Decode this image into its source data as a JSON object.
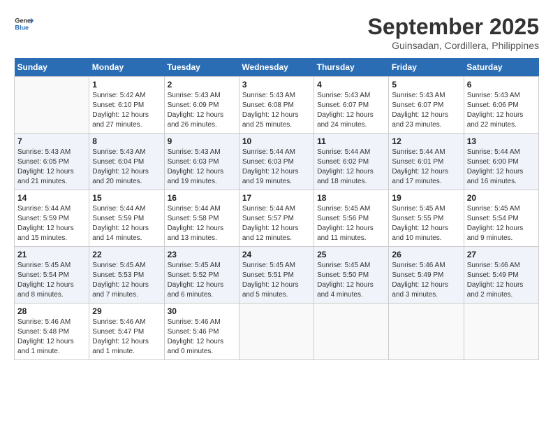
{
  "header": {
    "logo_line1": "General",
    "logo_line2": "Blue",
    "month": "September 2025",
    "location": "Guinsadan, Cordillera, Philippines"
  },
  "weekdays": [
    "Sunday",
    "Monday",
    "Tuesday",
    "Wednesday",
    "Thursday",
    "Friday",
    "Saturday"
  ],
  "weeks": [
    [
      {
        "day": "",
        "detail": ""
      },
      {
        "day": "1",
        "detail": "Sunrise: 5:42 AM\nSunset: 6:10 PM\nDaylight: 12 hours\nand 27 minutes."
      },
      {
        "day": "2",
        "detail": "Sunrise: 5:43 AM\nSunset: 6:09 PM\nDaylight: 12 hours\nand 26 minutes."
      },
      {
        "day": "3",
        "detail": "Sunrise: 5:43 AM\nSunset: 6:08 PM\nDaylight: 12 hours\nand 25 minutes."
      },
      {
        "day": "4",
        "detail": "Sunrise: 5:43 AM\nSunset: 6:07 PM\nDaylight: 12 hours\nand 24 minutes."
      },
      {
        "day": "5",
        "detail": "Sunrise: 5:43 AM\nSunset: 6:07 PM\nDaylight: 12 hours\nand 23 minutes."
      },
      {
        "day": "6",
        "detail": "Sunrise: 5:43 AM\nSunset: 6:06 PM\nDaylight: 12 hours\nand 22 minutes."
      }
    ],
    [
      {
        "day": "7",
        "detail": "Sunrise: 5:43 AM\nSunset: 6:05 PM\nDaylight: 12 hours\nand 21 minutes."
      },
      {
        "day": "8",
        "detail": "Sunrise: 5:43 AM\nSunset: 6:04 PM\nDaylight: 12 hours\nand 20 minutes."
      },
      {
        "day": "9",
        "detail": "Sunrise: 5:43 AM\nSunset: 6:03 PM\nDaylight: 12 hours\nand 19 minutes."
      },
      {
        "day": "10",
        "detail": "Sunrise: 5:44 AM\nSunset: 6:03 PM\nDaylight: 12 hours\nand 19 minutes."
      },
      {
        "day": "11",
        "detail": "Sunrise: 5:44 AM\nSunset: 6:02 PM\nDaylight: 12 hours\nand 18 minutes."
      },
      {
        "day": "12",
        "detail": "Sunrise: 5:44 AM\nSunset: 6:01 PM\nDaylight: 12 hours\nand 17 minutes."
      },
      {
        "day": "13",
        "detail": "Sunrise: 5:44 AM\nSunset: 6:00 PM\nDaylight: 12 hours\nand 16 minutes."
      }
    ],
    [
      {
        "day": "14",
        "detail": "Sunrise: 5:44 AM\nSunset: 5:59 PM\nDaylight: 12 hours\nand 15 minutes."
      },
      {
        "day": "15",
        "detail": "Sunrise: 5:44 AM\nSunset: 5:59 PM\nDaylight: 12 hours\nand 14 minutes."
      },
      {
        "day": "16",
        "detail": "Sunrise: 5:44 AM\nSunset: 5:58 PM\nDaylight: 12 hours\nand 13 minutes."
      },
      {
        "day": "17",
        "detail": "Sunrise: 5:44 AM\nSunset: 5:57 PM\nDaylight: 12 hours\nand 12 minutes."
      },
      {
        "day": "18",
        "detail": "Sunrise: 5:45 AM\nSunset: 5:56 PM\nDaylight: 12 hours\nand 11 minutes."
      },
      {
        "day": "19",
        "detail": "Sunrise: 5:45 AM\nSunset: 5:55 PM\nDaylight: 12 hours\nand 10 minutes."
      },
      {
        "day": "20",
        "detail": "Sunrise: 5:45 AM\nSunset: 5:54 PM\nDaylight: 12 hours\nand 9 minutes."
      }
    ],
    [
      {
        "day": "21",
        "detail": "Sunrise: 5:45 AM\nSunset: 5:54 PM\nDaylight: 12 hours\nand 8 minutes."
      },
      {
        "day": "22",
        "detail": "Sunrise: 5:45 AM\nSunset: 5:53 PM\nDaylight: 12 hours\nand 7 minutes."
      },
      {
        "day": "23",
        "detail": "Sunrise: 5:45 AM\nSunset: 5:52 PM\nDaylight: 12 hours\nand 6 minutes."
      },
      {
        "day": "24",
        "detail": "Sunrise: 5:45 AM\nSunset: 5:51 PM\nDaylight: 12 hours\nand 5 minutes."
      },
      {
        "day": "25",
        "detail": "Sunrise: 5:45 AM\nSunset: 5:50 PM\nDaylight: 12 hours\nand 4 minutes."
      },
      {
        "day": "26",
        "detail": "Sunrise: 5:46 AM\nSunset: 5:49 PM\nDaylight: 12 hours\nand 3 minutes."
      },
      {
        "day": "27",
        "detail": "Sunrise: 5:46 AM\nSunset: 5:49 PM\nDaylight: 12 hours\nand 2 minutes."
      }
    ],
    [
      {
        "day": "28",
        "detail": "Sunrise: 5:46 AM\nSunset: 5:48 PM\nDaylight: 12 hours\nand 1 minute."
      },
      {
        "day": "29",
        "detail": "Sunrise: 5:46 AM\nSunset: 5:47 PM\nDaylight: 12 hours\nand 1 minute."
      },
      {
        "day": "30",
        "detail": "Sunrise: 5:46 AM\nSunset: 5:46 PM\nDaylight: 12 hours\nand 0 minutes."
      },
      {
        "day": "",
        "detail": ""
      },
      {
        "day": "",
        "detail": ""
      },
      {
        "day": "",
        "detail": ""
      },
      {
        "day": "",
        "detail": ""
      }
    ]
  ]
}
